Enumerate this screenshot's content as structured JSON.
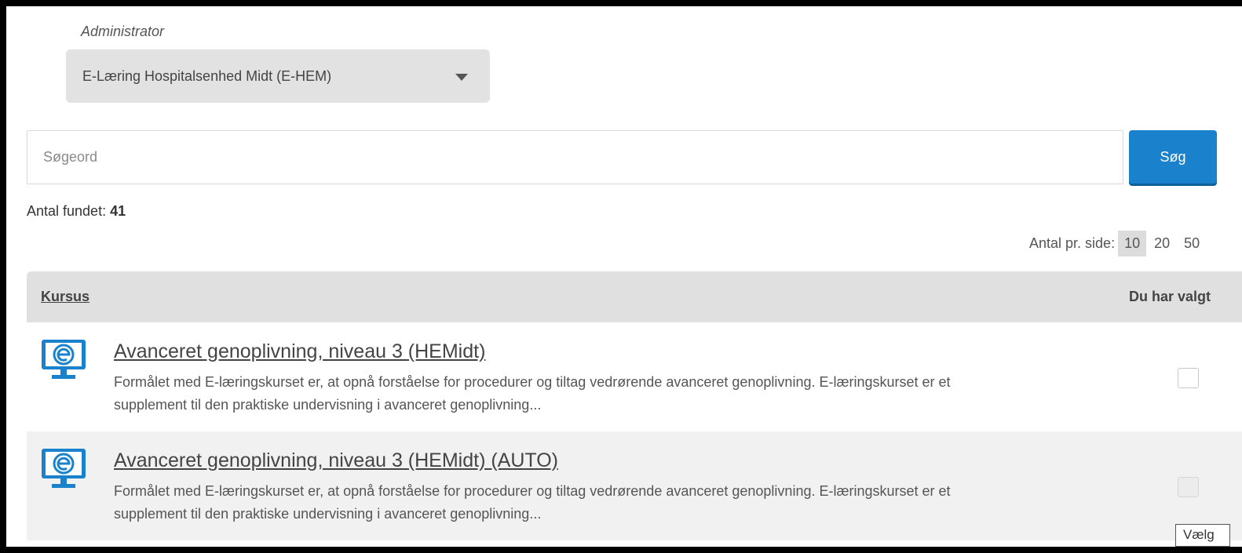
{
  "admin": {
    "label": "Administrator",
    "selected": "E-Læring Hospitalsenhed Midt (E-HEM)"
  },
  "search": {
    "placeholder": "Søgeord",
    "value": "",
    "button_label": "Søg"
  },
  "results": {
    "found_label": "Antal fundet:",
    "found_count": "41"
  },
  "pagination": {
    "per_page_label": "Antal pr. side:",
    "options": [
      "10",
      "20",
      "50"
    ],
    "selected": "10"
  },
  "table": {
    "col_course": "Kursus",
    "col_chosen": "Du har valgt",
    "rows": [
      {
        "title": "Avanceret genoplivning, niveau 3 (HEMidt)",
        "description": "Formålet med E-læringskurset er, at opnå forståelse for procedurer og tiltag vedrørende avanceret genoplivning. E-læringskurset er et supplement til den praktiske undervisning i avanceret genoplivning...",
        "icon": "elearning-monitor-icon",
        "checked": false
      },
      {
        "title": "Avanceret genoplivning, niveau 3 (HEMidt) (AUTO)",
        "description": "Formålet med E-læringskurset er, at opnå forståelse for procedurer og tiltag vedrørende avanceret genoplivning. E-læringskurset er et supplement til den praktiske undervisning i avanceret genoplivning...",
        "icon": "elearning-monitor-icon",
        "checked": false
      }
    ]
  },
  "tooltip": {
    "text": "Vælg"
  },
  "colors": {
    "accent": "#1a82cc",
    "header_bg": "#e0e0e0",
    "row_alt_bg": "#f1f1f1"
  }
}
